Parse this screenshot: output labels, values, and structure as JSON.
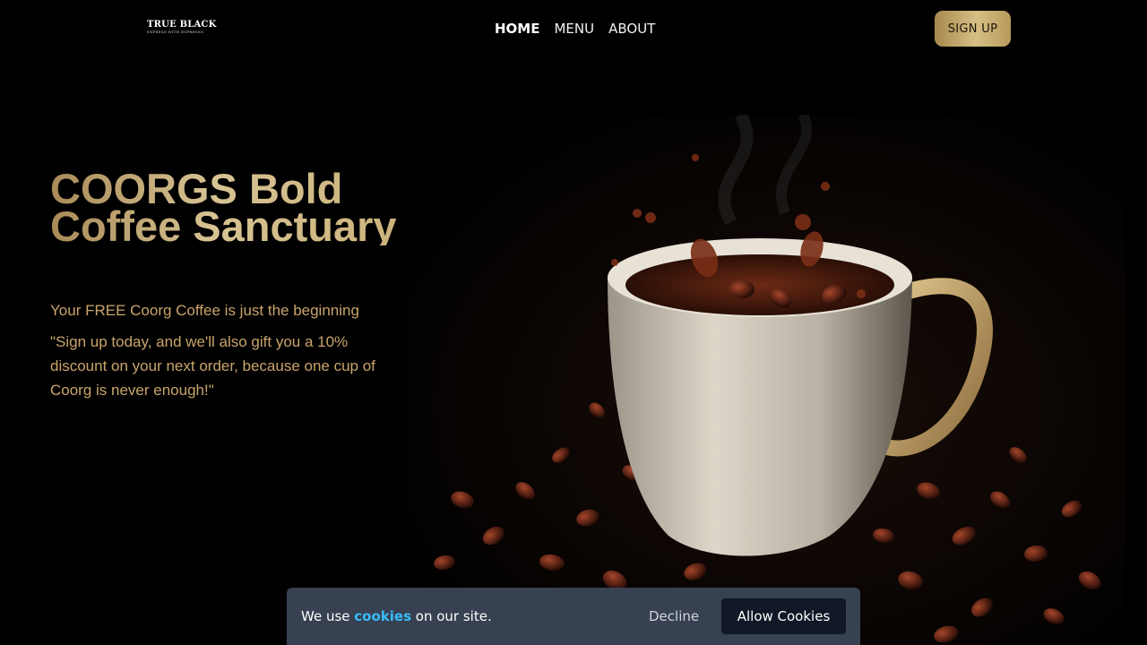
{
  "brand": {
    "name": "TRUE BLACK",
    "tagline": "EXPRESS WITH ESPRESSO"
  },
  "nav": {
    "items": [
      {
        "label": "HOME",
        "active": true
      },
      {
        "label": "MENU",
        "active": false
      },
      {
        "label": "ABOUT",
        "active": false
      }
    ],
    "signup_label": "SIGN UP"
  },
  "hero": {
    "title": "COORGS Bold Coffee Sanctuary",
    "subtitle": "Your FREE Coorg Coffee is just the beginning",
    "quote": "\"Sign up today, and we'll also gift you a 10% discount on your next order, because one cup of Coorg is never enough!\""
  },
  "cookie_banner": {
    "text_before": "We use",
    "link_text": "cookies",
    "text_after": "on our site.",
    "decline_label": "Decline",
    "allow_label": "Allow Cookies"
  },
  "colors": {
    "background": "#000000",
    "gold_accent": "#c9a46a",
    "cookie_banner_bg": "#374151",
    "cookie_link": "#38bdf8",
    "allow_button_bg": "#111827"
  }
}
